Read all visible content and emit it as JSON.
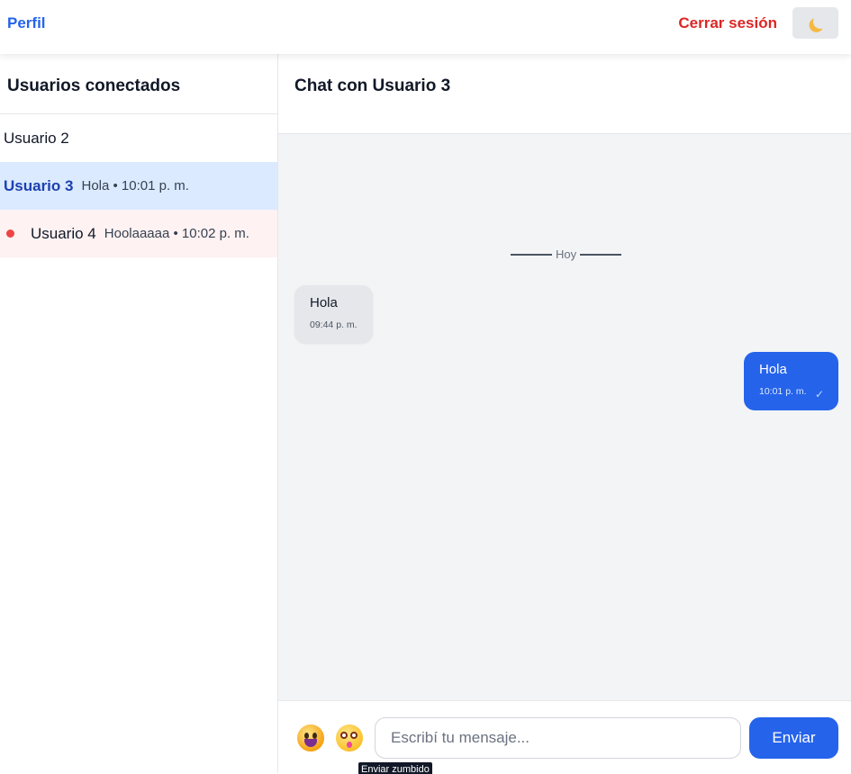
{
  "topbar": {
    "profile_label": "Perfil",
    "logout_label": "Cerrar sesión",
    "theme_icon": "moon-icon"
  },
  "sidebar": {
    "title": "Usuarios conectados",
    "users": [
      {
        "name": "Usuario 2",
        "preview": "",
        "status": "normal"
      },
      {
        "name": "Usuario 3",
        "preview": "Hola • 10:01 p. m.",
        "status": "active"
      },
      {
        "name": "Usuario 4",
        "preview": "Hoolaaaaa • 10:02 p. m.",
        "status": "unread"
      }
    ]
  },
  "chat": {
    "title": "Chat con Usuario 3",
    "day_separator": "Hoy",
    "messages": [
      {
        "direction": "in",
        "text": "Hola",
        "time": "09:44 p. m."
      },
      {
        "direction": "out",
        "text": "Hola",
        "time": "10:01 p. m.",
        "read_mark": "✓"
      }
    ]
  },
  "composer": {
    "emoji_icon": "grinning-face-icon",
    "buzz_icon": "shocked-face-icon",
    "placeholder": "Escribí tu mensaje...",
    "value": "",
    "send_label": "Enviar",
    "tooltip": "Enviar zumbido"
  },
  "colors": {
    "accent": "#2563eb",
    "danger": "#dc2626",
    "active_row": "#dbeafe",
    "unread_row": "#fef2f2",
    "chat_bg": "#f3f4f6"
  }
}
